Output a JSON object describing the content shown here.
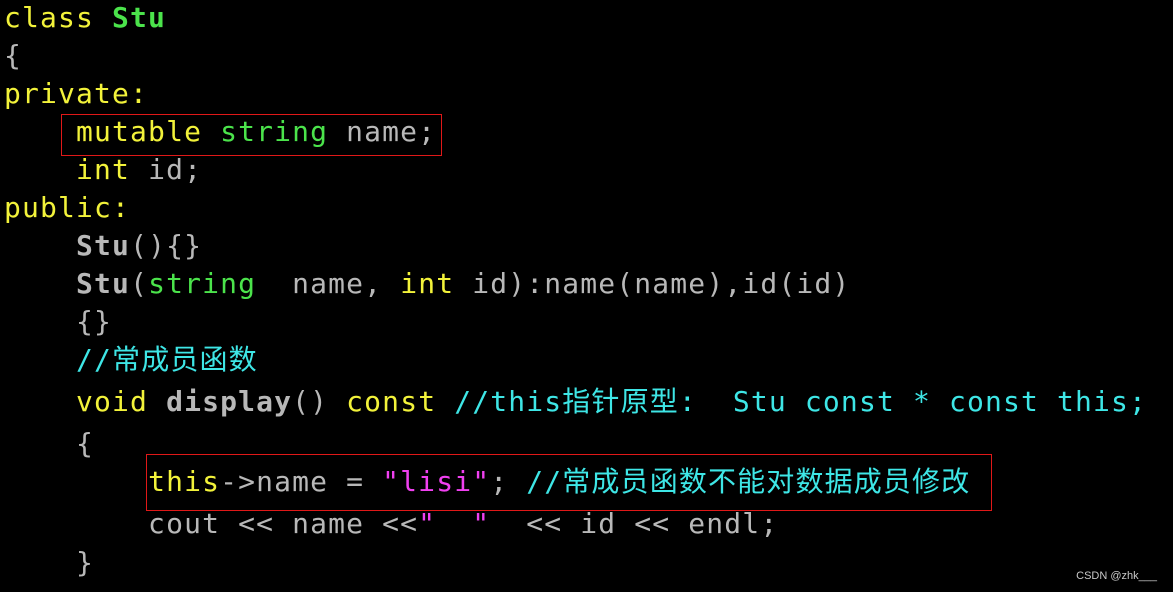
{
  "code_lines": [
    {
      "tokens": [
        {
          "t": "class ",
          "c": "kw"
        },
        {
          "t": "Stu",
          "c": "cls"
        }
      ]
    },
    {
      "tokens": [
        {
          "t": "{",
          "c": "id"
        }
      ]
    },
    {
      "tokens": [
        {
          "t": "private:",
          "c": "kw"
        }
      ]
    },
    {
      "tokens": [
        {
          "t": "    ",
          "c": "id"
        },
        {
          "t": "mutable ",
          "c": "kw"
        },
        {
          "t": "string ",
          "c": "type"
        },
        {
          "t": "name;",
          "c": "id"
        }
      ]
    },
    {
      "tokens": [
        {
          "t": "    ",
          "c": "id"
        },
        {
          "t": "int ",
          "c": "kw"
        },
        {
          "t": "id;",
          "c": "id"
        }
      ]
    },
    {
      "tokens": [
        {
          "t": "public:",
          "c": "kw"
        }
      ]
    },
    {
      "tokens": [
        {
          "t": "    ",
          "c": "id"
        },
        {
          "t": "Stu",
          "c": "fn"
        },
        {
          "t": "(){}",
          "c": "id"
        }
      ]
    },
    {
      "tokens": [
        {
          "t": "    ",
          "c": "id"
        },
        {
          "t": "Stu",
          "c": "fn"
        },
        {
          "t": "(",
          "c": "id"
        },
        {
          "t": "string",
          "c": "type"
        },
        {
          "t": "  name, ",
          "c": "id"
        },
        {
          "t": "int ",
          "c": "kw"
        },
        {
          "t": "id):name(name),id(id)",
          "c": "id"
        }
      ]
    },
    {
      "tokens": [
        {
          "t": "    {}",
          "c": "id"
        }
      ]
    },
    {
      "tokens": [
        {
          "t": "    ",
          "c": "id"
        },
        {
          "t": "//常成员函数",
          "c": "cm"
        }
      ]
    },
    {
      "tokens": [
        {
          "t": "    ",
          "c": "id"
        },
        {
          "t": "void ",
          "c": "kw"
        },
        {
          "t": "display",
          "c": "fn"
        },
        {
          "t": "() ",
          "c": "id"
        },
        {
          "t": "const ",
          "c": "kw"
        },
        {
          "t": "//this指针原型:  Stu const * const this;",
          "c": "cm"
        }
      ]
    },
    {
      "tokens": [
        {
          "t": "    {",
          "c": "id"
        }
      ]
    },
    {
      "tokens": [
        {
          "t": "        ",
          "c": "id"
        },
        {
          "t": "this",
          "c": "kw"
        },
        {
          "t": "->name = ",
          "c": "id"
        },
        {
          "t": "\"lisi\"",
          "c": "str"
        },
        {
          "t": "; ",
          "c": "id"
        },
        {
          "t": "//常成员函数不能对数据成员修改",
          "c": "cm"
        }
      ]
    },
    {
      "tokens": [
        {
          "t": "        cout << name <<",
          "c": "id"
        },
        {
          "t": "\"  \"",
          "c": "str"
        },
        {
          "t": "  << id << endl;",
          "c": "id"
        }
      ]
    },
    {
      "tokens": [
        {
          "t": "    }",
          "c": "id"
        }
      ]
    }
  ],
  "highlights": [
    {
      "label": "mutable-member-highlight",
      "line": 3
    },
    {
      "label": "const-violation-highlight",
      "line": 12
    }
  ],
  "watermark": "CSDN @zhk___"
}
